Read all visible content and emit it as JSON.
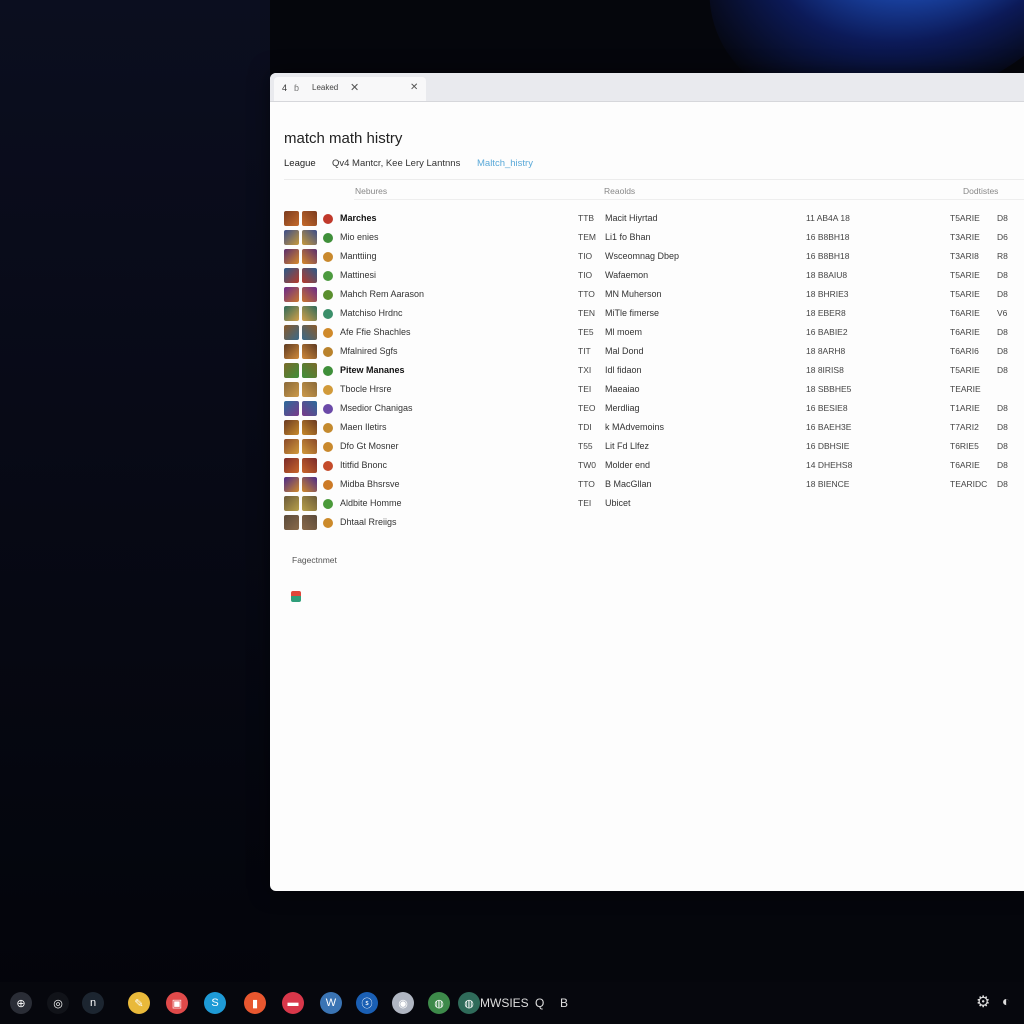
{
  "browser": {
    "tab": {
      "number": "4",
      "label": "Leaked",
      "close": "✕",
      "pin": "✕"
    }
  },
  "page": {
    "title": "match math histry",
    "nav": {
      "league": "League",
      "matches": "Qv4 Mantcr, Kee Lery Lantnns",
      "history": "Maltch_histry"
    },
    "columns": {
      "name": "Nebures",
      "result": "Reaolds",
      "date": "Dodtistes"
    },
    "rows": [
      {
        "name": "Marches",
        "bold": true,
        "code": "TTB",
        "result": "Macit Hiyrtad",
        "score": "11 AB4A 18",
        "time": "T5ARIE",
        "tag": "D8",
        "icon": "#c0392b"
      },
      {
        "name": "Mio enies",
        "bold": false,
        "code": "TEM",
        "result": "Li1 fo Bhan",
        "score": "16 B8BH18",
        "time": "T3ARIE",
        "tag": "D6",
        "icon": "#3f8f3a"
      },
      {
        "name": "Manttiing",
        "bold": false,
        "code": "TIO",
        "result": "Wsceomnag Dbep",
        "score": "16 B8BH18",
        "time": "T3ARI8",
        "tag": "R8",
        "icon": "#c9892d"
      },
      {
        "name": "Mattinesi",
        "bold": false,
        "code": "TIO",
        "result": "Wafaemon",
        "score": "18 B8AIU8",
        "time": "T5ARIE",
        "tag": "D8",
        "icon": "#4c9a3f"
      },
      {
        "name": "Mahch Rem Aarason",
        "bold": false,
        "code": "TTO",
        "result": "MN Muherson",
        "score": "18 BHRIE3",
        "time": "T5ARIE",
        "tag": "D8",
        "icon": "#5a8f2e"
      },
      {
        "name": "Matchiso Hrdnc",
        "bold": false,
        "code": "TEN",
        "result": "MiTle fimerse",
        "score": "18 EBER8",
        "time": "T6ARIE",
        "tag": "V6",
        "icon": "#3b8f6a"
      },
      {
        "name": "Afe Ffie Shachles",
        "bold": false,
        "code": "TE5",
        "result": "Ml moem",
        "score": "16 BABIE2",
        "time": "T6ARIE",
        "tag": "D8",
        "icon": "#d08a2a"
      },
      {
        "name": "Mfalnired Sgfs",
        "bold": false,
        "code": "TIT",
        "result": "Mal Dond",
        "score": "18 8ARH8",
        "time": "T6ARI6",
        "tag": "D8",
        "icon": "#b9822c"
      },
      {
        "name": "Pitew Mananes",
        "bold": true,
        "code": "TXI",
        "result": "Idl fidaon",
        "score": "18 8IRIS8",
        "time": "T5ARIE",
        "tag": "D8",
        "icon": "#3f8f3a"
      },
      {
        "name": "Tbocle Hrsre",
        "bold": false,
        "code": "TEI",
        "result": "Maeaiao",
        "score": "18 SBBHE5",
        "time": "TEARIE",
        "tag": "",
        "icon": "#d19a3a"
      },
      {
        "name": "Msedior Chanigas",
        "bold": false,
        "code": "TEO",
        "result": "Merdliag",
        "score": "16 BESIE8",
        "time": "T1ARIE",
        "tag": "D8",
        "icon": "#6b4aa8"
      },
      {
        "name": "Maen Iletirs",
        "bold": false,
        "code": "TDI",
        "result": "k MAdvemoins",
        "score": "16 BAEH3E",
        "time": "T7ARI2",
        "tag": "D8",
        "icon": "#c48a2e"
      },
      {
        "name": "Dfo Gt Mosner",
        "bold": false,
        "code": "T55",
        "result": "Lit Fd Llfez",
        "score": "16 DBHSIE",
        "time": "T6RIE5",
        "tag": "D8",
        "icon": "#c9892d"
      },
      {
        "name": "Ititfid Bnonc",
        "bold": false,
        "code": "TW0",
        "result": "Molder end",
        "score": "14 DHEHS8",
        "time": "T6ARIE",
        "tag": "D8",
        "icon": "#c44b2a"
      },
      {
        "name": "Midba Bhsrsve",
        "bold": false,
        "code": "TTO",
        "result": "B MacGllan",
        "score": "18 BIENCE",
        "time": "TEARIDC",
        "tag": "D8",
        "icon": "#cc7a26"
      },
      {
        "name": "Aldbite Homme",
        "bold": false,
        "code": "TEI",
        "result": "Ubicet",
        "score": "",
        "time": "",
        "tag": "",
        "icon": "#4b9a3a"
      },
      {
        "name": "Dhtaal Rreiigs",
        "bold": false,
        "code": "",
        "result": "",
        "score": "",
        "time": "",
        "tag": "",
        "icon": "#cc8a2a"
      }
    ],
    "footer": "Fagectnmet"
  },
  "taskbar": {
    "items": [
      {
        "name": "start-icon",
        "glyph": "⊕",
        "color": "#2a2d36"
      },
      {
        "name": "search-icon",
        "glyph": "◎",
        "color": "#111319"
      },
      {
        "name": "widget-icon",
        "glyph": "n",
        "color": "#1c2530"
      },
      {
        "name": "notes-icon",
        "glyph": "✎",
        "color": "#e9b93a"
      },
      {
        "name": "store-icon",
        "glyph": "▣",
        "color": "#e04a4a"
      },
      {
        "name": "skype-icon",
        "glyph": "S",
        "color": "#1e9ad6"
      },
      {
        "name": "office-icon",
        "glyph": "▮",
        "color": "#e8572f"
      },
      {
        "name": "mail-icon",
        "glyph": "▬",
        "color": "#d8374a"
      },
      {
        "name": "wordpress-icon",
        "glyph": "W",
        "color": "#3a74b4"
      },
      {
        "name": "app-blue-icon",
        "glyph": "ⓢ",
        "color": "#1a5fb4"
      },
      {
        "name": "app-round-icon",
        "glyph": "◉",
        "color": "#b0b6c2"
      },
      {
        "name": "chrome-icon",
        "glyph": "◍",
        "color": "#3d8a4a"
      }
    ],
    "label": "MWSIES",
    "search_glyph": "Q",
    "b_glyph": "B"
  }
}
